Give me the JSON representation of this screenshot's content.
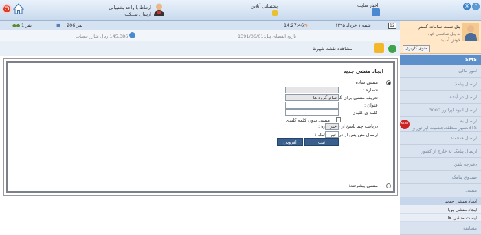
{
  "top": {
    "support_line1": "ارتباط با واحد پشتیبانی",
    "support_line2": "ارسال تیـــکت",
    "online_support": "پشتیبانی آنلاین",
    "news": "اخبار سایت"
  },
  "status": {
    "date": "شنبه ۱ خرداد ۱۳۹۵",
    "time": "14:27:46",
    "count_a": "206 نفر",
    "count_b": "1 نفر",
    "panel_expiry": "تاریخ انقضای پنل:1391/06/01",
    "balance": "145,386 ریال شارژ حساب",
    "view_map": "مشاهده نقشه شهرها"
  },
  "profile": {
    "name": "پنل تست سامانه گستر",
    "line1": "به پنل شخصی خود",
    "line2": "خوش آمدید",
    "user_button": "منوی کاربری"
  },
  "menu": {
    "head": "SMS",
    "items": [
      {
        "label": "امور مالی"
      },
      {
        "label": "ارسال پیامک"
      },
      {
        "label": "ارسال در آینده"
      },
      {
        "label": "ارسال انبوه اپراتور 3000"
      },
      {
        "label": "ارسال به BTS،شهر،منطقه،جنسیت،اپراتور و ..."
      },
      {
        "label": "ارسال هدفمند"
      },
      {
        "label": "ارسال پیامک به خارج از کشور"
      },
      {
        "label": "دفترچه تلفن"
      },
      {
        "label": "صندوق پیامک"
      },
      {
        "label": "منشی"
      }
    ],
    "sub_items": [
      {
        "label": "ایجاد منشی جدید"
      },
      {
        "label": "ایجاد منشی پویا"
      },
      {
        "label": "لیست منشی ها"
      }
    ],
    "last_item": "مسابقه"
  },
  "form": {
    "title": "ایجاد منشی جدید",
    "simple_secretary": "منشی ساده:",
    "number_label": "شماره :",
    "group_label": "تعریف منشی برای گروه:",
    "group_value": "تمام گروه ها",
    "title_label": "عنوان :",
    "keyword_label": "کلمه ی کلیدی :",
    "no_keyword": "منشی بدون کلمه کلیدی",
    "multi_reply": "دریافت چند پاسخ از یک شماره :",
    "multi_reply_value": "خیر",
    "send_after": "ارسال متن پس از دریافت پیامک :",
    "send_after_value": "خیر",
    "submit": "ثبت",
    "add": "افزودن",
    "advanced": "منشی پیشرفته:"
  }
}
